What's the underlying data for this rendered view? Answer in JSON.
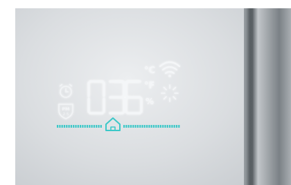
{
  "display": {
    "temperature": "036",
    "unit_celsius": "°C",
    "unit_fahrenheit": "°F",
    "unit_percent": "%",
    "mode_badge_line1": "PM",
    "mode_badge_line2": "2.5",
    "segment_color": "#f4f6f8",
    "bar_color": "#3cc8c8"
  },
  "icons": [
    "alarm-clock-icon",
    "pm-shield-icon",
    "wifi-icon",
    "sun-icon",
    "home-icon"
  ]
}
